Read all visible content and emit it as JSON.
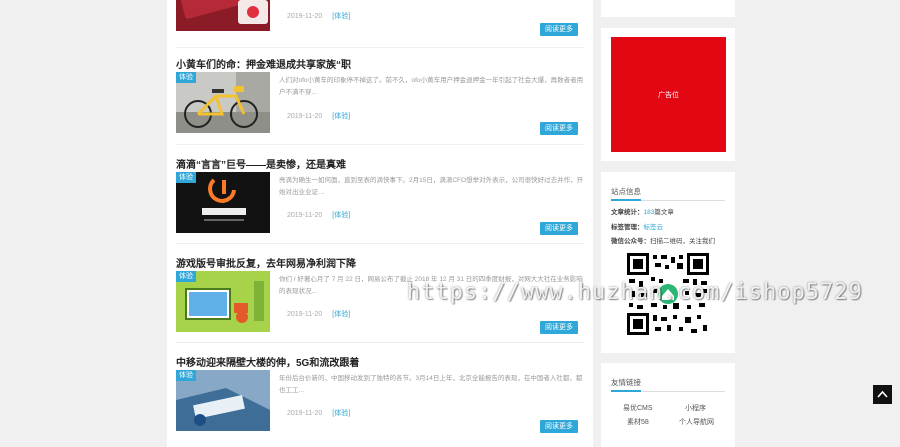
{
  "articles": [
    {
      "title": "",
      "tag": "",
      "summary": "",
      "date": "2019-11-20",
      "category": "[体验]",
      "more": "阅读更多"
    },
    {
      "title": "小黄车们的命：押金难退成共享家族“职",
      "tag": "体验",
      "summary": "人们对ofo小黄车的印象停不掉这了。前不久，ofo小黄车用户押金退押金一年引起了社会大爆，再数者者用户不满不穿…",
      "date": "2019-11-20",
      "category": "[体验]",
      "more": "阅读更多"
    },
    {
      "title": "滴滴“言言”巨号——是卖惨，还是真难",
      "tag": "体验",
      "summary": "亮滴为确生一如何面，直到至表的滴快事下。2月15日，滴滴CFO想举对外表示，公司很快好过去并作，开始对出业业证…",
      "date": "2019-11-20",
      "category": "[体验]",
      "more": "阅读更多"
    },
    {
      "title": "游戏版号审批反复，去年网易净利润下降",
      "tag": "体验",
      "summary": "你们 / 好著心月了 7 月 22 日，网易公布了截止 2018 年 12 月 31 日的四季度财报，对网大大社在业务影响的表现状况…",
      "date": "2019-11-20",
      "category": "[体验]",
      "more": "阅读更多"
    },
    {
      "title": "中移动迎来隔壁大楼的伸，5G和流改跟着",
      "tag": "体验",
      "summary": "年份后台价新的，中国移动发到了独特的各节。3月14日上年，北京全能报告的表现，在中国者入社都，都也工工…",
      "date": "2019-11-20",
      "category": "[体验]",
      "more": "阅读更多"
    }
  ],
  "ad": {
    "label": "广告位"
  },
  "site_info": {
    "title": "站点信息",
    "article_label": "文章统计：",
    "article_count": "183",
    "article_suffix": "篇文章",
    "tag_label": "标签管理：",
    "tag_value": "标签云",
    "wechat_label": "微信公众号：",
    "wechat_value": "扫描二维码，关注我们"
  },
  "links": {
    "title": "友情链接",
    "items": [
      "易优CMS",
      "小程序",
      "素材58",
      "个人导航网"
    ]
  },
  "watermark": "https://www.huzhan.com/ishop5729",
  "colors": {
    "accent": "#2fa7d8",
    "ad": "#e30613"
  }
}
